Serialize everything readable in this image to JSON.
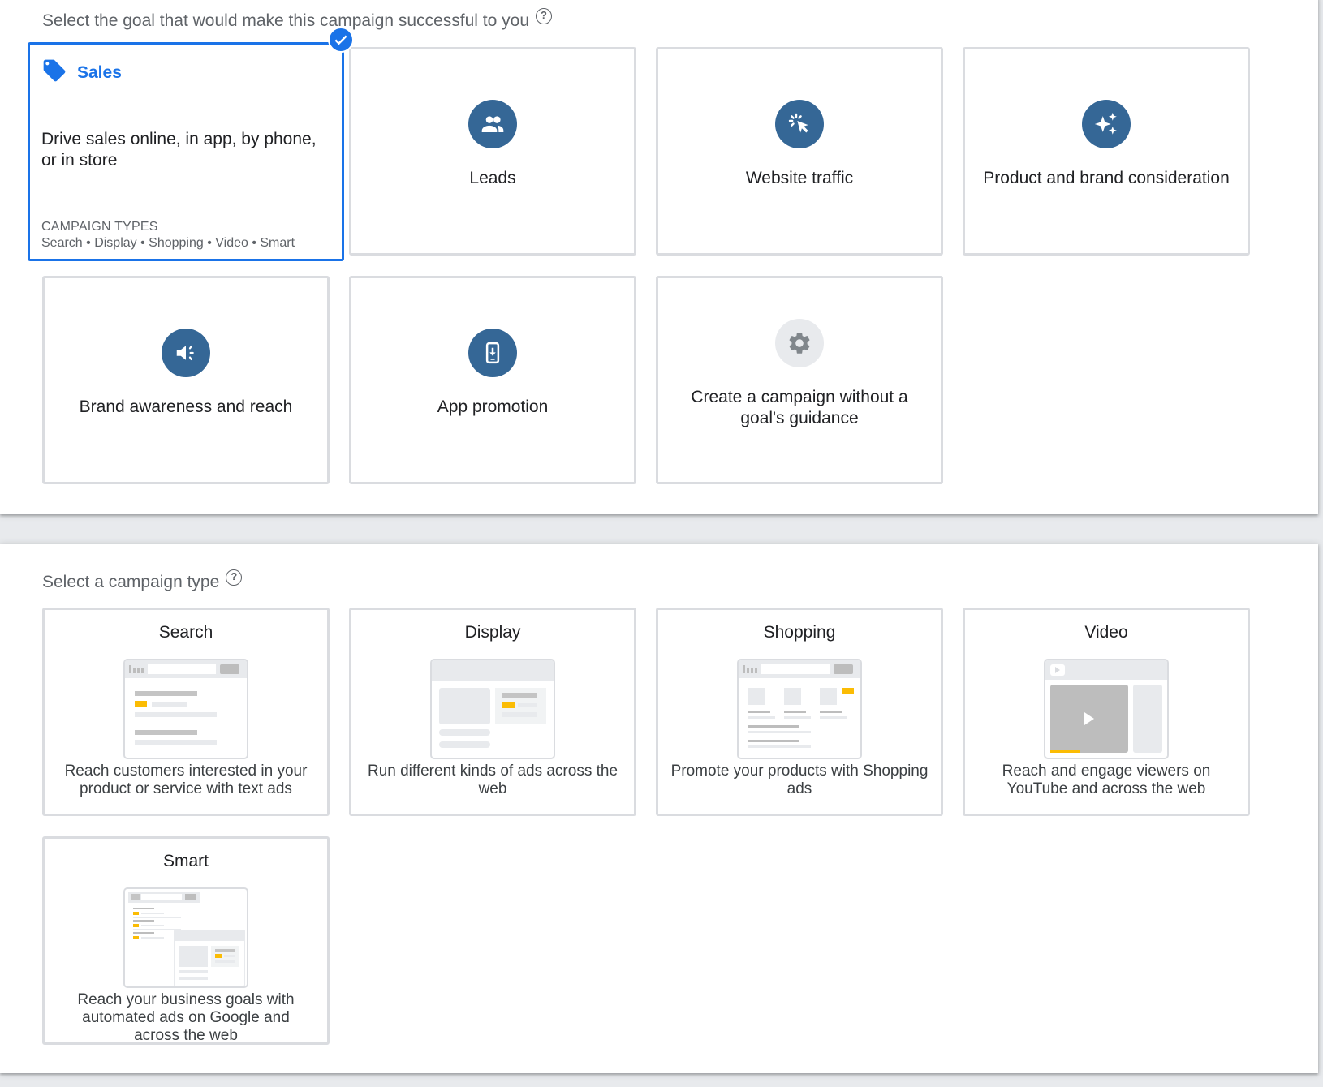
{
  "goals_section": {
    "title": "Select the goal that would make this campaign successful to you",
    "help_icon": "?",
    "selected_goal": "Sales",
    "sales": {
      "title": "Sales",
      "icon": "tag-icon",
      "description": "Drive sales online, in app, by phone, or in store",
      "campaign_types_label": "CAMPAIGN TYPES",
      "campaign_types": "Search • Display • Shopping • Video • Smart"
    },
    "goals": [
      {
        "label": "Leads",
        "icon": "people-icon"
      },
      {
        "label": "Website traffic",
        "icon": "cursor-click-icon"
      },
      {
        "label": "Product and brand consideration",
        "icon": "sparkle-icon"
      },
      {
        "label": "Brand awareness and reach",
        "icon": "megaphone-icon"
      },
      {
        "label": "App promotion",
        "icon": "phone-download-icon"
      },
      {
        "label": "Create a campaign without a goal's guidance",
        "icon": "gear-icon"
      }
    ]
  },
  "types_section": {
    "title": "Select a campaign type",
    "help_icon": "?",
    "types": [
      {
        "title": "Search",
        "description": "Reach customers interested in your product or service with text ads"
      },
      {
        "title": "Display",
        "description": "Run different kinds of ads across the web"
      },
      {
        "title": "Shopping",
        "description": "Promote your products with Shopping ads"
      },
      {
        "title": "Video",
        "description": "Reach and engage viewers on YouTube and across the web"
      },
      {
        "title": "Smart",
        "description": "Reach your business goals with automated ads on Google and across the web"
      }
    ]
  },
  "colors": {
    "accent": "#1a73e8",
    "icon_circle": "#356796",
    "card_border": "#dadce0",
    "highlight_yellow": "#fbbc04"
  }
}
